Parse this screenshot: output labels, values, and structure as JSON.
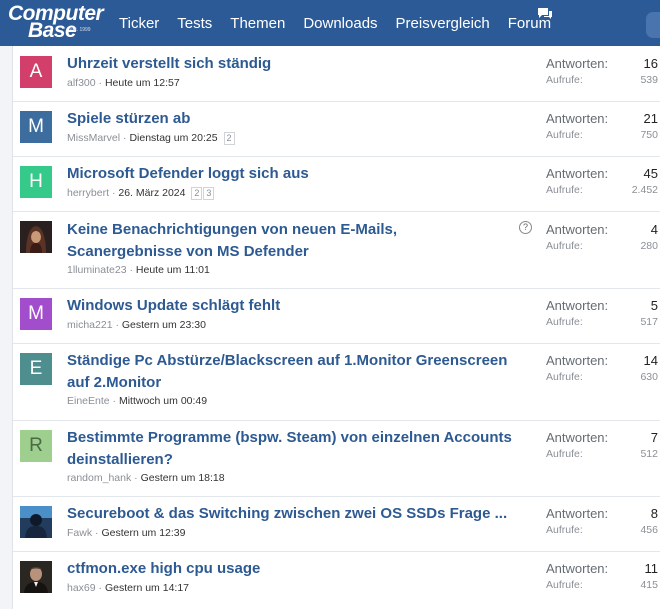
{
  "logo": {
    "line1": "Computer",
    "line2": "Base",
    "since": "est. 1999"
  },
  "nav": [
    "Ticker",
    "Tests",
    "Themen",
    "Downloads",
    "Preisvergleich",
    "Forum"
  ],
  "labels": {
    "replies": "Antworten:",
    "views": "Aufrufe:"
  },
  "threads": [
    {
      "avatar": "A",
      "avatar_color": "#d23f6b",
      "title": "Uhrzeit verstellt sich ständig",
      "user": "alf300",
      "date": "Heute um 12:57",
      "pages": [],
      "replies": "16",
      "views": "539"
    },
    {
      "avatar": "M",
      "avatar_color": "#3d6c9e",
      "title": "Spiele stürzen ab",
      "user": "MissMarvel",
      "date": "Dienstag um 20:25",
      "pages": [
        "2"
      ],
      "replies": "21",
      "views": "750"
    },
    {
      "avatar": "H",
      "avatar_color": "#35c98a",
      "title": "Microsoft Defender loggt sich aus",
      "user": "herrybert",
      "date": "26. März 2024",
      "pages": [
        "2",
        "3"
      ],
      "replies": "45",
      "views": "2.452"
    },
    {
      "avatar": "",
      "avatar_color": "#3a2a2a",
      "title": "Keine Benachrichtigungen von neuen E-Mails, Scanergebnisse von MS Defender",
      "user": "1lluminate23",
      "date": "Heute um 11:01",
      "pages": [],
      "replies": "4",
      "views": "280"
    },
    {
      "avatar": "M",
      "avatar_color": "#a24dcc",
      "title": "Windows Update schlägt fehlt",
      "user": "micha221",
      "date": "Gestern um 23:30",
      "pages": [],
      "replies": "5",
      "views": "517"
    },
    {
      "avatar": "E",
      "avatar_color": "#4f8e8e",
      "title": "Ständige Pc Abstürze/Blackscreen auf 1.Monitor Greenscreen auf 2.Monitor",
      "user": "EineEnte",
      "date": "Mittwoch um 00:49",
      "pages": [],
      "replies": "14",
      "views": "630"
    },
    {
      "avatar": "R",
      "avatar_color": "#9fcf8f",
      "title": "Bestimmte Programme (bspw. Steam) von einzelnen Accounts deinstallieren?",
      "user": "random_hank",
      "date": "Gestern um 18:18",
      "pages": [],
      "replies": "7",
      "views": "512"
    },
    {
      "avatar": "",
      "avatar_color": "#223c5e",
      "title": "Secureboot & das Switching zwischen zwei OS SSDs Frage ...",
      "user": "Fawk",
      "date": "Gestern um 12:39",
      "pages": [],
      "replies": "8",
      "views": "456"
    },
    {
      "avatar": "",
      "avatar_color": "#2a2622",
      "title": "ctfmon.exe high cpu usage",
      "user": "hax69",
      "date": "Gestern um 14:17",
      "pages": [],
      "replies": "11",
      "views": "415"
    }
  ]
}
